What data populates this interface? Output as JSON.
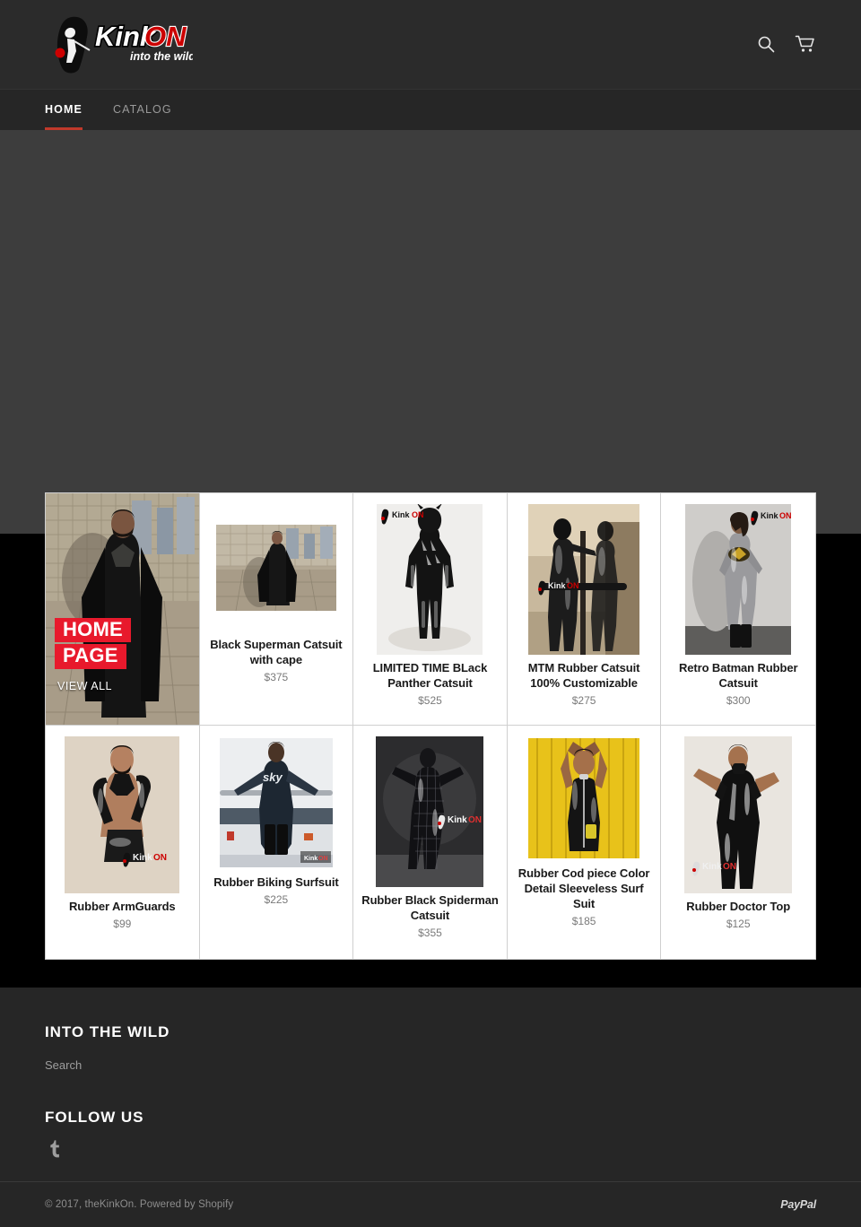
{
  "header": {
    "logo": {
      "brand_primary": "Kink",
      "brand_accent": "ON",
      "tagline": "into the wild",
      "accent_color": "#cc0000"
    },
    "search_icon": "search-icon",
    "cart_icon": "cart-icon"
  },
  "nav": {
    "items": [
      {
        "label": "Home",
        "active": true
      },
      {
        "label": "Catalog",
        "active": false
      }
    ],
    "active_underline_color": "#c0392b"
  },
  "hero": {
    "background_color": "#3d3d3d"
  },
  "collection_promo": {
    "title_line1": "HOME",
    "title_line2": "PAGE",
    "view_all": "VIEW ALL",
    "badge_color": "#e8192c"
  },
  "products": [
    {
      "title": "Black Superman Catsuit with cape",
      "price": "$375"
    },
    {
      "title": "LIMITED TIME BLack Panther Catsuit",
      "price": "$525"
    },
    {
      "title": "MTM Rubber Catsuit 100% Customizable",
      "price": "$275"
    },
    {
      "title": "Retro Batman Rubber Catsuit",
      "price": "$300"
    },
    {
      "title": "Rubber ArmGuards",
      "price": "$99"
    },
    {
      "title": "Rubber Biking Surfsuit",
      "price": "$225"
    },
    {
      "title": "Rubber Black Spiderman Catsuit",
      "price": "$355"
    },
    {
      "title": "Rubber Cod piece Color Detail Sleeveless Surf Suit",
      "price": "$185"
    },
    {
      "title": "Rubber Doctor Top",
      "price": "$125"
    }
  ],
  "footer": {
    "menu_heading": "INTO THE WILD",
    "menu_links": [
      "Search"
    ],
    "follow_heading": "FOLLOW US",
    "social": [
      {
        "name": "tumblr-icon",
        "glyph": "t"
      }
    ]
  },
  "copyright": {
    "text": "© 2017, theKinkOn. Powered by Shopify",
    "payment": "PayPal"
  }
}
